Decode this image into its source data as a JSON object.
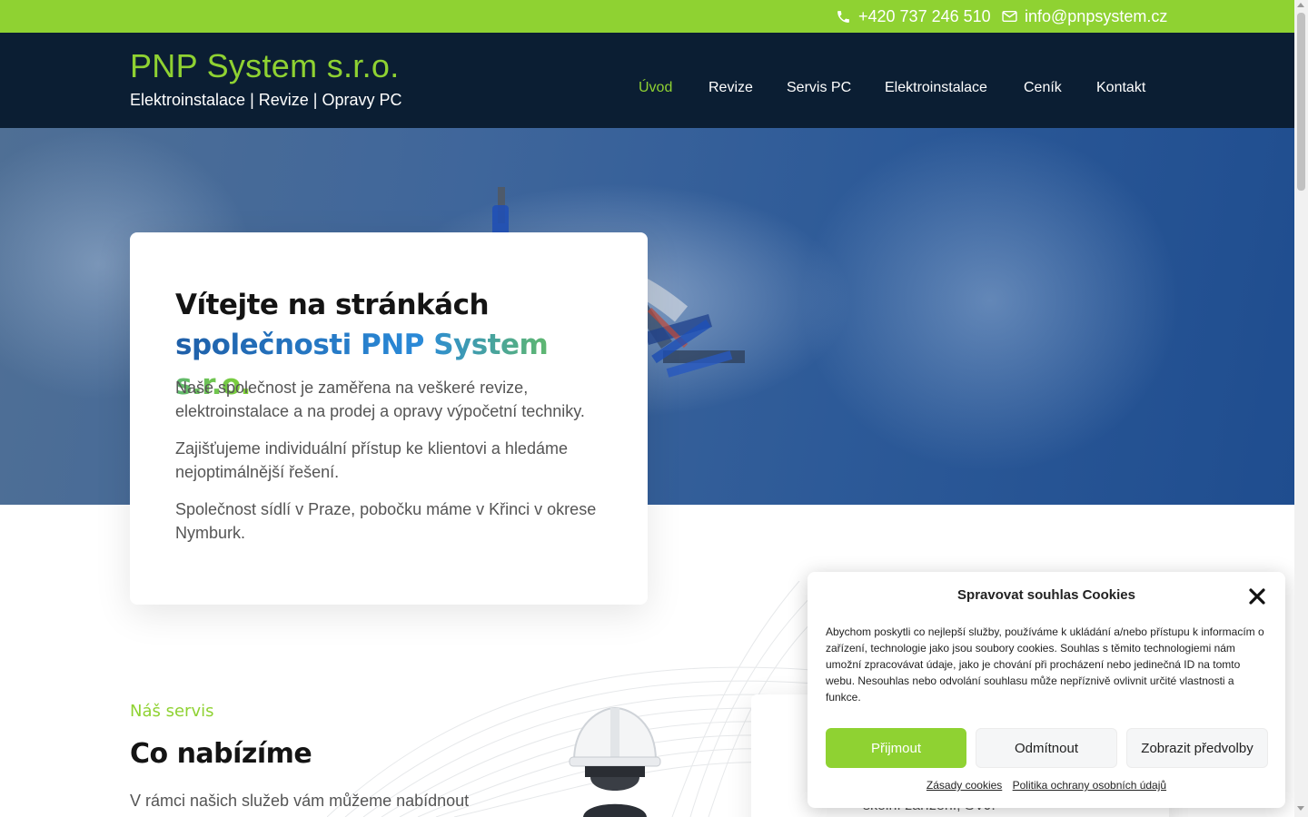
{
  "topbar": {
    "phone": "+420 737 246 510",
    "email": "info@pnpsystem.cz",
    "phone_icon": "phone-icon",
    "email_icon": "envelope-icon",
    "bg_color": "#8fd232"
  },
  "header": {
    "brand": "PNP System s.r.o.",
    "tagline": "Elektroinstalace | Revize | Opravy PC",
    "bg_color": "#0b1e33"
  },
  "nav": {
    "items": [
      {
        "label": "Úvod",
        "active": true
      },
      {
        "label": "Revize",
        "active": false
      },
      {
        "label": "Servis PC",
        "active": false
      },
      {
        "label": "Elektroinstalace",
        "active": false
      },
      {
        "label": "Ceník",
        "active": false
      },
      {
        "label": "Kontakt",
        "active": false
      }
    ]
  },
  "welcome": {
    "title_line1": "Vítejte na stránkách",
    "title_line2": "společnosti PNP System s.r.o.",
    "p1": "Naše společnost je zaměřena na veškeré revize, elektroinstalace a na prodej a opravy výpočetní techniky.",
    "p2": "Zajišťujeme individuální přístup ke klientovi a hledáme nejoptimálnější řešení.",
    "p3": "Společnost sídlí v Praze, pobočku máme v Křinci v okrese Nymburk."
  },
  "services": {
    "label": "Náš servis",
    "title": "Co nabízíme",
    "intro": "V rámci našich služeb vám můžeme nabídnout",
    "card_text": "školní zařízení, SVJ."
  },
  "cookie": {
    "title": "Spravovat souhlas Cookies",
    "body": "Abychom poskytli co nejlepší služby, používáme k ukládání a/nebo přístupu k informacím o zařízení, technologie jako jsou soubory cookies. Souhlas s těmito technologiemi nám umožní zpracovávat údaje, jako je chování při procházení nebo jedinečná ID na tomto webu. Nesouhlas nebo odvolání souhlasu může nepříznivě ovlivnit určité vlastnosti a funkce.",
    "accept": "Přijmout",
    "deny": "Odmítnout",
    "preferences": "Zobrazit předvolby",
    "link_cookies": "Zásady cookies",
    "link_privacy": "Politika ochrany osobních údajů",
    "accent_color": "#8fd232"
  }
}
